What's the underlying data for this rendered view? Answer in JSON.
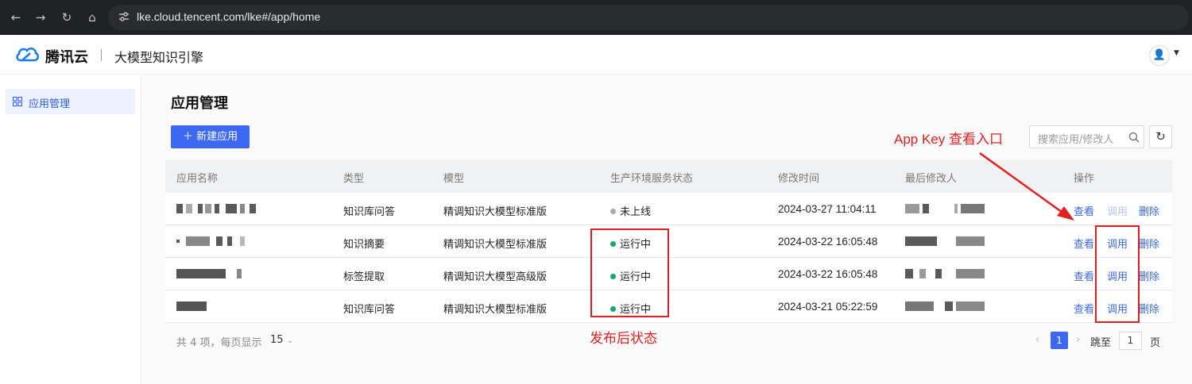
{
  "browser": {
    "url": "lke.cloud.tencent.com/lke#/app/home",
    "nav_icons": [
      "back-arrow-icon",
      "forward-arrow-icon",
      "reload-icon",
      "home-icon"
    ]
  },
  "header": {
    "brand": "腾讯云",
    "product": "大模型知识引擎",
    "user_icon": "user-icon"
  },
  "sidebar": {
    "items": [
      {
        "label": "应用管理",
        "icon": "grid-icon"
      }
    ]
  },
  "main": {
    "title": "应用管理",
    "new_button": "新建应用",
    "search_placeholder": "搜索应用/修改人"
  },
  "table": {
    "headers": [
      "应用名称",
      "类型",
      "模型",
      "生产环境服务状态",
      "修改时间",
      "最后修改人",
      "操作"
    ],
    "rows": [
      {
        "type": "知识库问答",
        "model": "精调知识大模型标准版",
        "status": "未上线",
        "status_color": "#a9a9b5",
        "time": "2024-03-27 11:04:11",
        "actions": {
          "view": "查看",
          "call": "调用",
          "delete": "删除"
        },
        "call_enabled": false
      },
      {
        "type": "知识摘要",
        "model": "精调知识大模型标准版",
        "status": "运行中",
        "status_color": "#15a86b",
        "time": "2024-03-22 16:05:48",
        "actions": {
          "view": "查看",
          "call": "调用",
          "delete": "删除"
        },
        "call_enabled": true
      },
      {
        "type": "标签提取",
        "model": "精调知识大模型高级版",
        "status": "运行中",
        "status_color": "#15a86b",
        "time": "2024-03-22 16:05:48",
        "actions": {
          "view": "查看",
          "call": "调用",
          "delete": "删除"
        },
        "call_enabled": true
      },
      {
        "type": "知识库问答",
        "model": "精调知识大模型标准版",
        "status": "运行中",
        "status_color": "#15a86b",
        "time": "2024-03-21 05:22:59",
        "actions": {
          "view": "查看",
          "call": "调用",
          "delete": "删除"
        },
        "call_enabled": true
      }
    ]
  },
  "pagination": {
    "total": "共 4 项，每页显示",
    "page_size": "15",
    "current": "1",
    "jump_label": "跳至",
    "jump_value": "1",
    "page_suffix": "页"
  },
  "annotations": {
    "app_key_label": "App Key 查看入口",
    "status_label": "发布后状态",
    "color": "#e02020"
  },
  "colors": {
    "accent": "#3d68f2",
    "running": "#15a86b",
    "offline": "#a9a9b5"
  }
}
